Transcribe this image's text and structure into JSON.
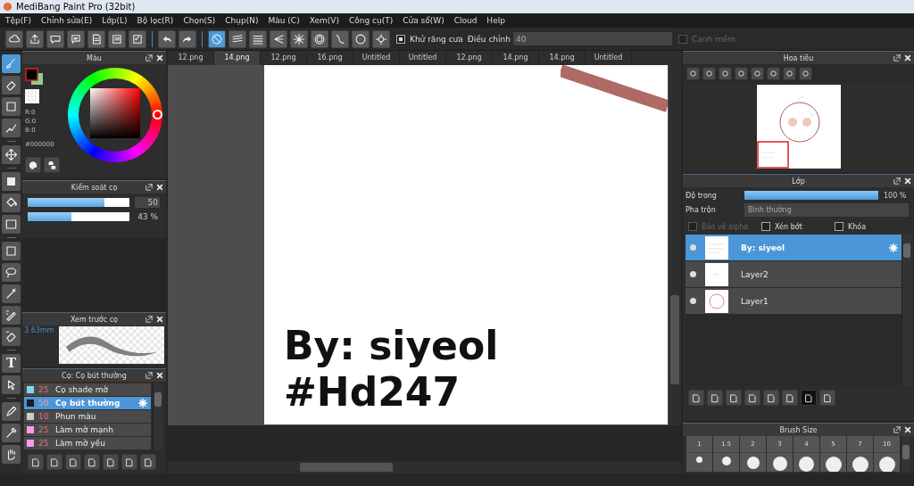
{
  "window": {
    "title": "MediBang Paint Pro (32bit)"
  },
  "menu": [
    "Tệp(F)",
    "Chỉnh sửa(E)",
    "Lớp(L)",
    "Bộ lọc(R)",
    "Chọn(S)",
    "Chụp(N)",
    "Màu (C)",
    "Xem(V)",
    "Công cụ(T)",
    "Cửa sổ(W)",
    "Cloud",
    "Help"
  ],
  "toolbar": {
    "antialias": {
      "label": "Khử răng cưa",
      "checked": true
    },
    "adjust": {
      "label": "Điều chỉnh",
      "value": "40"
    },
    "soft_edge": {
      "label": "Cạnh mềm",
      "checked": false
    }
  },
  "tools": [
    {
      "selected": true
    },
    {
      "selected": false
    },
    {
      "selected": false
    },
    {
      "selected": false
    },
    {
      "selected": false
    },
    {
      "selected": false
    },
    {
      "selected": false
    },
    {
      "selected": false
    },
    {
      "selected": false
    },
    {
      "selected": false
    },
    {
      "selected": false
    },
    {
      "selected": false
    },
    {
      "selected": false
    },
    {
      "selected": false,
      "glyph": "T"
    },
    {
      "selected": false
    },
    {
      "selected": false
    },
    {
      "selected": false
    },
    {
      "selected": false
    }
  ],
  "color_panel": {
    "title": "Màu",
    "r": "R:0",
    "g": "G:0",
    "b": "B:0",
    "hex": "#000000"
  },
  "brush_control": {
    "title": "Kiểm soát cọ",
    "sliders": [
      {
        "level": 0.75,
        "reading": "50"
      },
      {
        "level": 0.43,
        "reading": "43 %"
      }
    ]
  },
  "brush_preview": {
    "title": "Xem trước cọ",
    "size": "3.63mm"
  },
  "brush_list": {
    "title": "Cọ: Cọ bút thường",
    "items": [
      {
        "color": "#7fd8f0",
        "size": "25",
        "name": "Cọ shade mờ",
        "selected": false
      },
      {
        "color": "#1a1a2a",
        "size": "50",
        "name": "Cọ bút thường",
        "selected": true
      },
      {
        "color": "#cccccc",
        "size": "10",
        "name": "Phun màu",
        "selected": false
      },
      {
        "color": "#ff99ee",
        "size": "25",
        "name": "Làm mờ mạnh",
        "selected": false
      },
      {
        "color": "#ff99ee",
        "size": "25",
        "name": "Làm mờ yếu",
        "selected": false
      }
    ]
  },
  "tabs": [
    {
      "label": "12.png",
      "selected": false
    },
    {
      "label": "14.png",
      "selected": true
    },
    {
      "label": "12.png",
      "selected": false
    },
    {
      "label": "16.png",
      "selected": false
    },
    {
      "label": "Untitled",
      "selected": false
    },
    {
      "label": "Untitled",
      "selected": false
    },
    {
      "label": "12.png",
      "selected": false
    },
    {
      "label": "14.png",
      "selected": false
    },
    {
      "label": "14.png",
      "selected": false
    },
    {
      "label": "Untitled",
      "selected": false
    }
  ],
  "canvas": {
    "lines": [
      "By: siyeol",
      "#Hd247"
    ]
  },
  "navigator": {
    "title": "Hoa tiêu"
  },
  "layers": {
    "title": "Lớp",
    "opacity": {
      "label": "Độ trong",
      "level": 1,
      "reading": "100 %"
    },
    "blend": {
      "label": "Pha trộn",
      "value": "Bình thường"
    },
    "options": [
      {
        "label": "Bảo vệ alpha",
        "checked": false,
        "disabled": true
      },
      {
        "label": "Xén bớt",
        "checked": false,
        "disabled": false
      },
      {
        "label": "Khóa",
        "checked": false,
        "disabled": false
      }
    ],
    "items": [
      {
        "name": "By: siyeol",
        "selected": true
      },
      {
        "name": "Layer2",
        "selected": false
      },
      {
        "name": "Layer1",
        "selected": false
      }
    ]
  },
  "brush_size": {
    "title": "Brush Size",
    "sizes": [
      "1",
      "1.5",
      "2",
      "3",
      "4",
      "5",
      "7",
      "10"
    ]
  }
}
